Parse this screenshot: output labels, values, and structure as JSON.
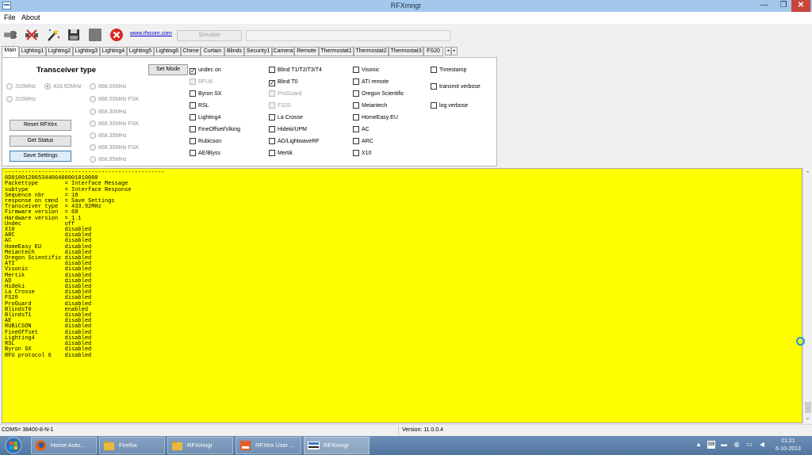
{
  "window": {
    "title": "RFXmngr",
    "min_glyph": "—",
    "max_glyph": "❐",
    "close_glyph": "✕"
  },
  "menu": {
    "file": "File",
    "about": "About"
  },
  "toolbar": {
    "link": "www.rfxcom.com",
    "simulate": "Simulate"
  },
  "tabs": [
    "Main",
    "Lighting1",
    "Lighting2",
    "Lighting3",
    "Lighting4",
    "Lighting5",
    "Lighting6",
    "Chime",
    "Curtain",
    "Blinds",
    "Security1",
    "Camera",
    "Remote",
    "Thermostat1",
    "Thermostat2",
    "Thermostat3",
    "FS20"
  ],
  "tab_scroll": {
    "left": "◂",
    "right": "▸"
  },
  "main": {
    "transceiver_title": "Transceiver type",
    "set_mode": "Set Mode",
    "reset": "Reset RFXtrx",
    "get_status": "Get Status",
    "save_settings": "Save Settings",
    "radios": [
      {
        "label": "310MHz",
        "selected": false
      },
      {
        "label": "433.92MHz",
        "selected": true
      },
      {
        "label": "868.00MHz",
        "selected": false
      },
      {
        "label": "315MHz",
        "selected": false
      },
      {
        "label": "868.00MHz FSK",
        "selected": false
      },
      {
        "label": "868.30MHz",
        "selected": false
      },
      {
        "label": "868.30MHz FSK",
        "selected": false
      },
      {
        "label": "868.35MHz",
        "selected": false
      },
      {
        "label": "868.35MHz FSK",
        "selected": false
      },
      {
        "label": "868.95MHz",
        "selected": false
      }
    ],
    "checkboxes": [
      {
        "label": "undec on",
        "checked": true,
        "disabled": false
      },
      {
        "label": "RFU6",
        "checked": false,
        "disabled": true
      },
      {
        "label": "Byron SX",
        "checked": false,
        "disabled": false
      },
      {
        "label": "RSL",
        "checked": false,
        "disabled": false
      },
      {
        "label": "Lighting4",
        "checked": false,
        "disabled": false
      },
      {
        "label": "FineOffset/Viking",
        "checked": false,
        "disabled": false
      },
      {
        "label": "Rubicson",
        "checked": false,
        "disabled": false
      },
      {
        "label": "AE/Blyss",
        "checked": false,
        "disabled": false
      },
      {
        "label": "Blind T1/T2/T3/T4",
        "checked": false,
        "disabled": false
      },
      {
        "label": "Blind T0",
        "checked": true,
        "disabled": false
      },
      {
        "label": "ProGuard",
        "checked": false,
        "disabled": true
      },
      {
        "label": "FS20",
        "checked": false,
        "disabled": true
      },
      {
        "label": "La Crosse",
        "checked": false,
        "disabled": false
      },
      {
        "label": "Hideki/UPM",
        "checked": false,
        "disabled": false
      },
      {
        "label": "AD/LightwaveRF",
        "checked": false,
        "disabled": false
      },
      {
        "label": "Mertik",
        "checked": false,
        "disabled": false
      },
      {
        "label": "Visonic",
        "checked": false,
        "disabled": false
      },
      {
        "label": "ATI remote",
        "checked": false,
        "disabled": false
      },
      {
        "label": "Oregon Scientific",
        "checked": false,
        "disabled": false
      },
      {
        "label": "Meiantech",
        "checked": false,
        "disabled": false
      },
      {
        "label": "HomeEasy EU",
        "checked": false,
        "disabled": false
      },
      {
        "label": "AC",
        "checked": false,
        "disabled": false
      },
      {
        "label": "ARC",
        "checked": false,
        "disabled": false
      },
      {
        "label": "X10",
        "checked": false,
        "disabled": false
      },
      {
        "label": "Timestamp",
        "checked": false,
        "disabled": false
      },
      {
        "label": "transmit verbose",
        "checked": false,
        "disabled": false
      },
      {
        "label": "log verbose",
        "checked": false,
        "disabled": false
      }
    ]
  },
  "log_lines": [
    "------------------------------------------------",
    "0D01001206534400400001010000",
    "Packettype        = Interface Message",
    "subtype           = Interface Response",
    "Sequence nbr      = 18",
    "response on cmnd  = Save Settings",
    "Transceiver type  = 433.92MHz",
    "Firmware version  = 68",
    "Hardware version  = 1.1",
    "Undec             off",
    "X10               disabled",
    "ARC               disabled",
    "AC                disabled",
    "HomeEasy EU       disabled",
    "Meiantech         disabled",
    "Oregon Scientific disabled",
    "ATI               disabled",
    "Visonic           disabled",
    "Mertik            disabled",
    "AD                disabled",
    "Hideki            disabled",
    "La Crosse         disabled",
    "FS20              disabled",
    "ProGuard          disabled",
    "BlindsT0          enabled",
    "BlindsT1          disabled",
    "AE                disabled",
    "RUBiCSON          disabled",
    "FineOffset        disabled",
    "Lighting4         disabled",
    "RSL               disabled",
    "Byron SX          disabled",
    "RFU protocol 6    disabled"
  ],
  "status": {
    "port": "COM5= 38400-8-N-1",
    "version": "Version: 11.0.0.4"
  },
  "taskbar": {
    "tasks": [
      "Home Auto...",
      "Firefox",
      "RFXmngr",
      "RFXtrx User ...",
      "RFXmngr"
    ],
    "time": "21:21",
    "date": "6-10-2013",
    "tray_up": "▲"
  },
  "colors": {
    "log_bg": "#ffff00",
    "titlebar": "#a4c8ec",
    "taskbar": "#5f84ad"
  }
}
